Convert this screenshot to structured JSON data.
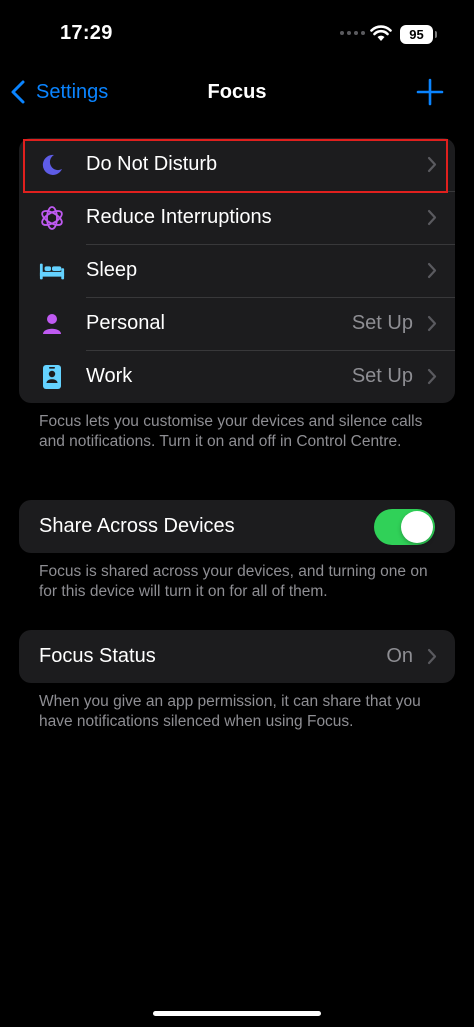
{
  "status_bar": {
    "time": "17:29",
    "battery": "95"
  },
  "nav": {
    "back_label": "Settings",
    "title": "Focus"
  },
  "focus_modes": [
    {
      "label": "Do Not Disturb",
      "value": "",
      "icon": "moon-icon",
      "color": "#5e5ce6"
    },
    {
      "label": "Reduce Interruptions",
      "value": "",
      "icon": "flower-icon",
      "color": "#bf5af2"
    },
    {
      "label": "Sleep",
      "value": "",
      "icon": "bed-icon",
      "color": "#64d2ff"
    },
    {
      "label": "Personal",
      "value": "Set Up",
      "icon": "person-icon",
      "color": "#bf5af2"
    },
    {
      "label": "Work",
      "value": "Set Up",
      "icon": "id-badge-icon",
      "color": "#64d2ff"
    }
  ],
  "focus_note": "Focus lets you customise your devices and silence calls and notifications. Turn it on and off in Control Centre.",
  "share": {
    "label": "Share Across Devices",
    "enabled": true
  },
  "share_note": "Focus is shared across your devices, and turning one on for this device will turn it on for all of them.",
  "status": {
    "label": "Focus Status",
    "value": "On"
  },
  "status_note": "When you give an app permission, it can share that you have notifications silenced when using Focus.",
  "colors": {
    "accent": "#0a84ff",
    "toggle_on": "#30d158",
    "highlight": "#e0201e"
  }
}
